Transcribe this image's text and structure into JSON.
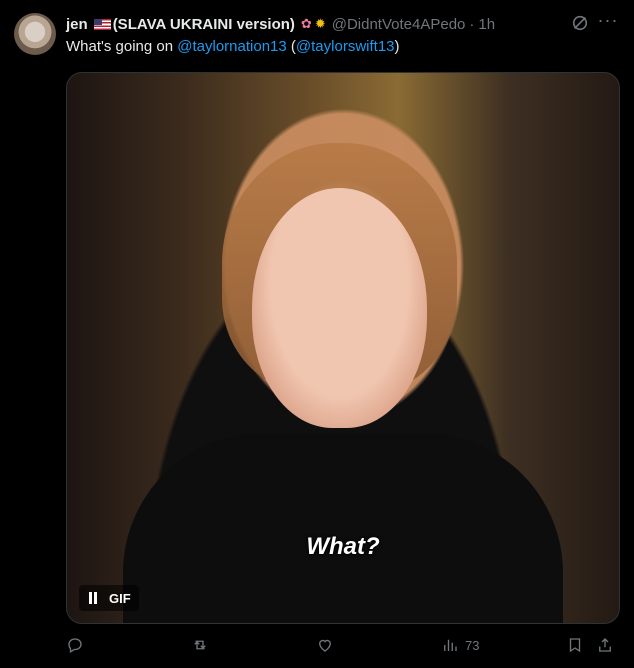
{
  "tweet": {
    "author_name": "jen",
    "name_suffix": "(SLAVA UKRAINI version)",
    "handle": "@DidntVote4APedo",
    "separator": "·",
    "time": "1h",
    "text_prefix": "What's going on ",
    "mention1": "@taylornation13",
    "open_paren": " (",
    "mention2": "@taylorswift13",
    "close_paren": ")"
  },
  "media": {
    "caption": "What?",
    "badge": "GIF"
  },
  "actions": {
    "views": "73"
  },
  "colors": {
    "background": "#000000",
    "text": "#e7e9ea",
    "muted": "#71767b",
    "link": "#1d9bf0"
  },
  "icons": [
    "avatar",
    "us-flag-icon",
    "lotus-icon",
    "sunflower-icon",
    "grok-icon",
    "more-icon",
    "pause-icon",
    "reply-icon",
    "retweet-icon",
    "like-icon",
    "views-icon",
    "bookmark-icon",
    "share-icon"
  ]
}
